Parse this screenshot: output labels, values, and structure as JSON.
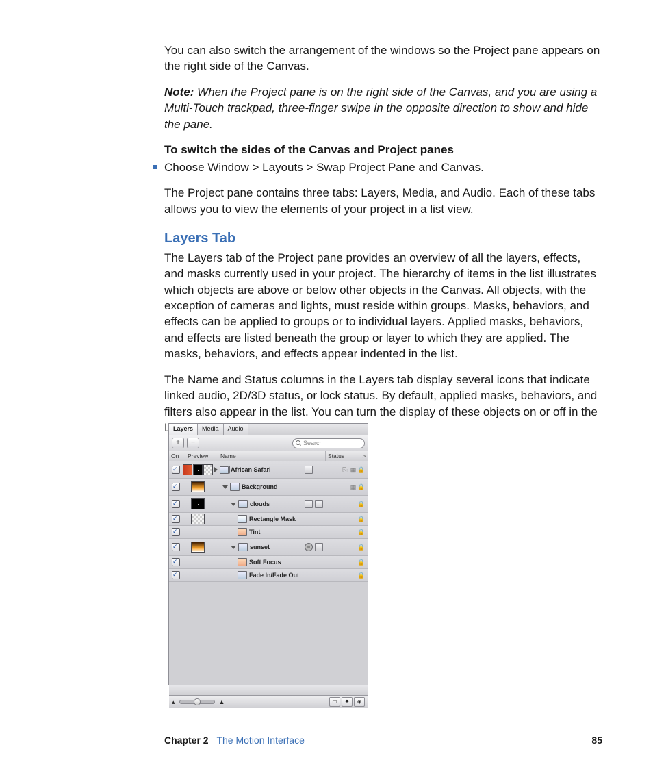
{
  "body": {
    "p1": "You can also switch the arrangement of the windows so the Project pane appears on the right side of the Canvas.",
    "note_label": "Note:",
    "note_text": "  When the Project pane is on the right side of the Canvas, and you are using a Multi-Touch trackpad, three-finger swipe in the opposite direction to show and hide the pane.",
    "howto_head": "To switch the sides of the Canvas and Project panes",
    "howto_step": "Choose Window > Layouts > Swap Project Pane and Canvas.",
    "p2": "The Project pane contains three tabs: Layers, Media, and Audio. Each of these tabs allows you to view the elements of your project in a list view.",
    "section_head": "Layers Tab",
    "p3": "The Layers tab of the Project pane provides an overview of all the layers, effects, and masks currently used in your project. The hierarchy of items in the list illustrates which objects are above or below other objects in the Canvas. All objects, with the exception of cameras and lights, must reside within groups. Masks, behaviors, and effects can be applied to groups or to individual layers. Applied masks, behaviors, and effects are listed beneath the group or layer to which they are applied. The masks, behaviors, and effects appear indented in the list.",
    "p4": "The Name and Status columns in the Layers tab display several icons that indicate linked audio, 2D/3D status, or lock status. By default, applied masks, behaviors, and filters also appear in the list. You can turn the display of these objects on or off in the Layers tab."
  },
  "panel": {
    "tabs": {
      "layers": "Layers",
      "media": "Media",
      "audio": "Audio"
    },
    "toolbar": {
      "add": "+",
      "remove": "−"
    },
    "search_placeholder": "Search",
    "columns": {
      "on": "On",
      "preview": "Preview",
      "name": "Name",
      "status": "Status",
      "corner": ">"
    },
    "rows": [
      {
        "indent": 0,
        "disclosure": "right",
        "name": "African Safari",
        "checked": true,
        "previews": [
          "red",
          "dot",
          "checker"
        ],
        "icons": [
          "ic"
        ],
        "status": [
          "link",
          "2d3d",
          "lock"
        ]
      },
      {
        "indent": 1,
        "disclosure": "down",
        "name": "Background",
        "checked": true,
        "previews": [
          "orange"
        ],
        "icons": [],
        "status": [
          "2d3d",
          "lock"
        ]
      },
      {
        "indent": 2,
        "disclosure": "down",
        "name": "clouds",
        "checked": true,
        "previews": [
          "dot"
        ],
        "icons": [
          "ic",
          "ic"
        ],
        "status": [
          "lock"
        ]
      },
      {
        "indent": 3,
        "disclosure": "",
        "name": "Rectangle Mask",
        "checked": true,
        "previews": [
          "checker"
        ],
        "icons": [],
        "status": [
          "lock"
        ],
        "short": true
      },
      {
        "indent": 3,
        "disclosure": "",
        "name": "Tint",
        "checked": true,
        "previews": [],
        "icons": [],
        "status": [
          "lock"
        ],
        "short": true
      },
      {
        "indent": 2,
        "disclosure": "down",
        "name": "sunset",
        "checked": true,
        "previews": [
          "orange"
        ],
        "icons": [
          "gear",
          "ic"
        ],
        "status": [
          "lock"
        ]
      },
      {
        "indent": 3,
        "disclosure": "",
        "name": "Soft Focus",
        "checked": true,
        "previews": [],
        "icons": [],
        "status": [
          "lock"
        ],
        "short": true
      },
      {
        "indent": 3,
        "disclosure": "",
        "name": "Fade In/Fade Out",
        "checked": true,
        "previews": [],
        "icons": [],
        "status": [
          "lock"
        ],
        "short": true
      }
    ]
  },
  "footer": {
    "chapter_label": "Chapter 2",
    "chapter_name": "The Motion Interface",
    "page": "85"
  }
}
